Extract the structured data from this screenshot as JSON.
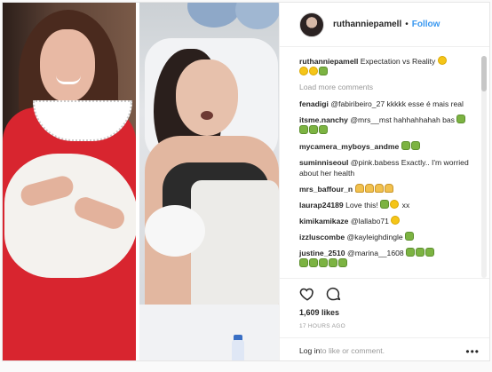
{
  "post": {
    "username": "ruthanniepamell",
    "follow_separator": "•",
    "follow_label": "Follow",
    "caption_user": "ruthanniepamell",
    "caption_text": "Expectation vs Reality",
    "load_more": "Load more comments",
    "likes": "1,609 likes",
    "time": "17 HOURS AGO",
    "login_text": "Log in",
    "login_suffix": " to like or comment.",
    "more_label": "•••"
  },
  "comments": [
    {
      "user": "fenadigi",
      "text": "@fabiribeiro_27 kkkkk esse é mais real"
    },
    {
      "user": "itsme.nanchy",
      "text": "@mrs__mst hahhahhahah bas"
    },
    {
      "user": "mycamera_myboys_andme",
      "text": ""
    },
    {
      "user": "suminniseoul",
      "text": "@pink.babess Exactly.. I'm worried about her health"
    },
    {
      "user": "mrs_baffour_n",
      "text": ""
    },
    {
      "user": "laurap24189",
      "text": "Love this!"
    },
    {
      "user": "kimikamikaze",
      "text": "@lallabo71"
    },
    {
      "user": "izzluscombe",
      "text": "@kayleighdingle"
    },
    {
      "user": "justine_2510",
      "text": "@marina__1608"
    }
  ],
  "colors": {
    "accent": "#3897f0",
    "dress": "#d8252f"
  },
  "icons": {
    "like": "heart-icon",
    "comment": "comment-icon",
    "more": "more-options-icon"
  }
}
